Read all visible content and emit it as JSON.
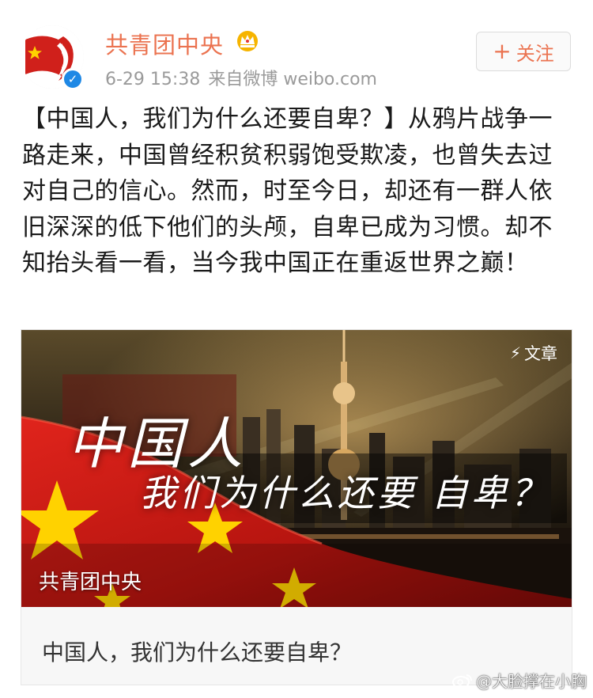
{
  "header": {
    "user_name": "共青团中央",
    "time": "6-29 15:38",
    "source": "来自微博 weibo.com",
    "follow_label": "关注",
    "follow_icon": "plus-icon",
    "verified_icon": "verified-badge-icon",
    "vip_icon": "crown-icon"
  },
  "post": {
    "text": "【中国人，我们为什么还要自卑？】从鸦片战争一路走来，中国曾经积贫积弱饱受欺凌，也曾失去过对自己的信心。然而，时至今日，却还有一群人依旧深深的低下他们的头颅，自卑已成为习惯。却不知抬头看一看，当今我中国正在重返世界之巅！"
  },
  "card": {
    "badge_label": "文章",
    "badge_icon": "lightning-icon",
    "image_headline_1": "中国人",
    "image_headline_2": "我们为什么还要 自卑？",
    "image_caption": "共青团中央",
    "title": "中国人，我们为什么还要自卑？"
  },
  "watermark": {
    "text": "@大脸撑在小胸",
    "icon": "weibo-logo-icon"
  },
  "colors": {
    "accent": "#eb7350",
    "meta_gray": "#9a9a9a",
    "verified_blue": "#1e88e5",
    "flag_red": "#d0201b",
    "flag_yellow": "#ffd200"
  }
}
